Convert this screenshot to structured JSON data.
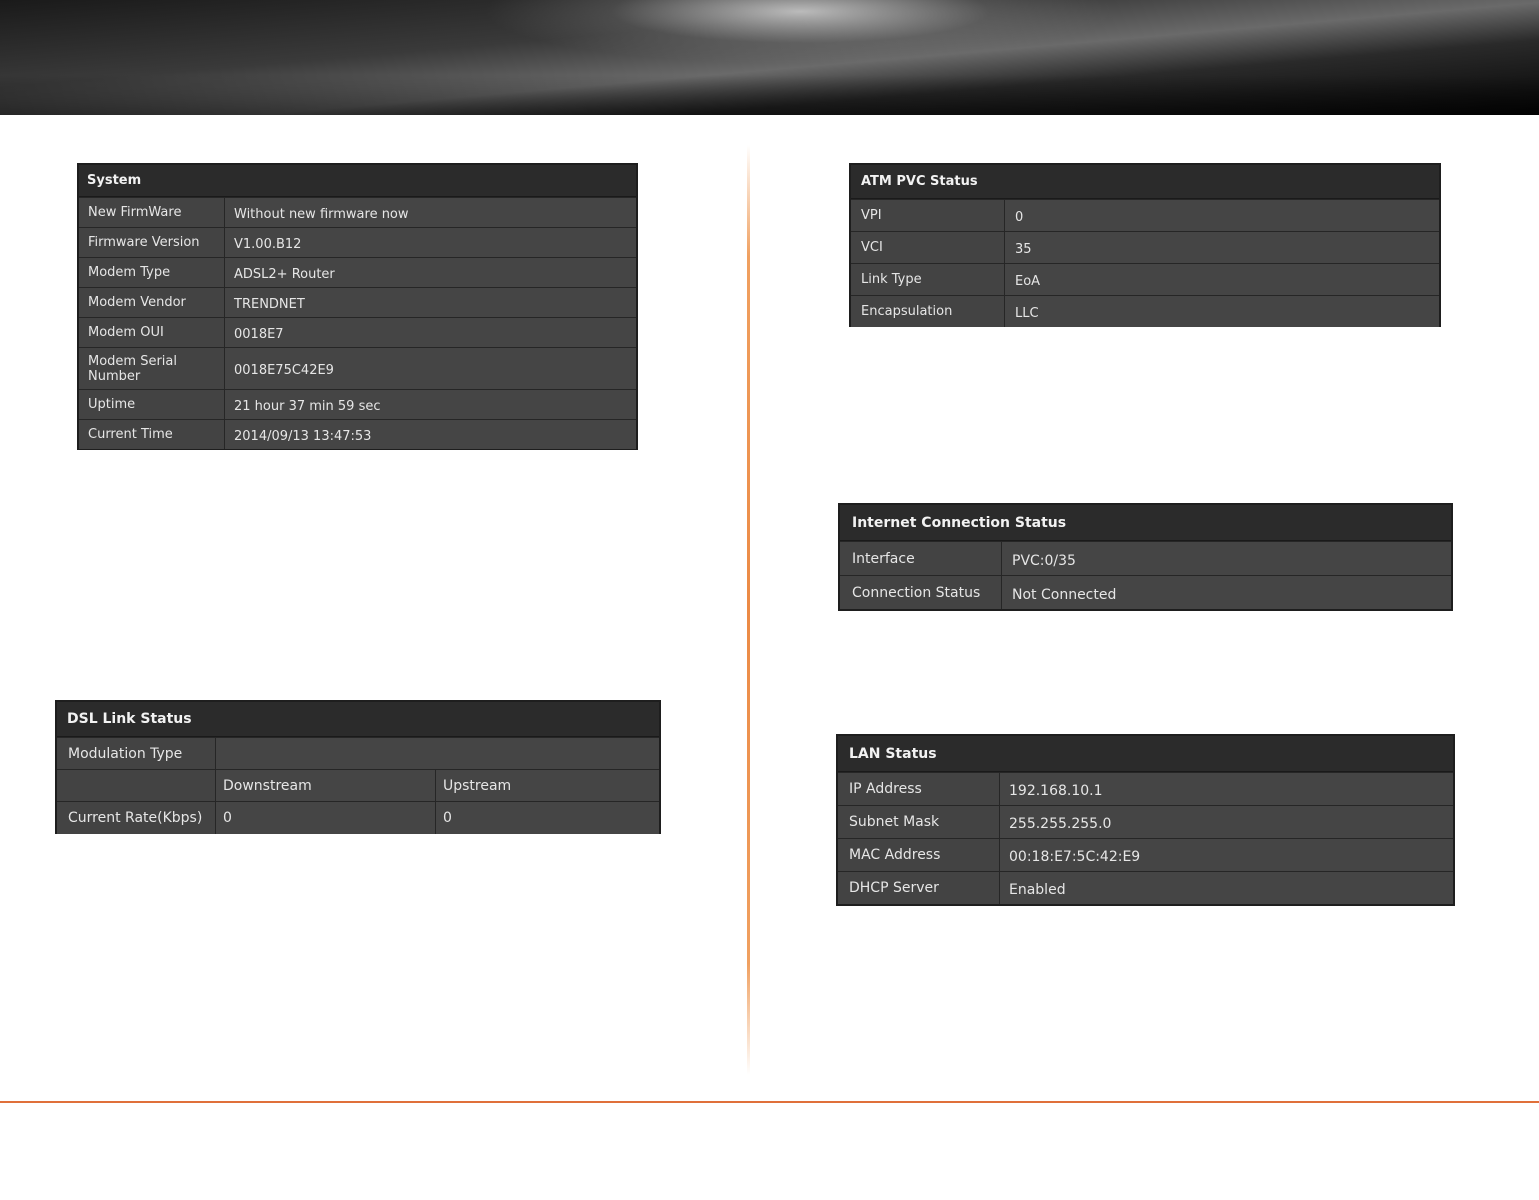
{
  "system": {
    "title": "System",
    "rows": [
      {
        "label": "New FirmWare",
        "value": "Without new firmware now"
      },
      {
        "label": "Firmware Version",
        "value": "V1.00.B12"
      },
      {
        "label": "Modem Type",
        "value": "ADSL2+ Router"
      },
      {
        "label": "Modem Vendor",
        "value": "TRENDNET"
      },
      {
        "label": "Modem OUI",
        "value": "0018E7"
      },
      {
        "label": "Modem Serial Number",
        "value": "0018E75C42E9"
      },
      {
        "label": "Uptime",
        "value": "21 hour 37 min 59 sec"
      },
      {
        "label": "Current Time",
        "value": "2014/09/13 13:47:53"
      }
    ]
  },
  "atm": {
    "title": "ATM PVC Status",
    "rows": [
      {
        "label": "VPI",
        "value": "0"
      },
      {
        "label": "VCI",
        "value": "35"
      },
      {
        "label": "Link Type",
        "value": "EoA"
      },
      {
        "label": "Encapsulation",
        "value": "LLC"
      }
    ]
  },
  "internet": {
    "title": "Internet Connection Status",
    "rows": [
      {
        "label": "Interface",
        "value": "PVC:0/35"
      },
      {
        "label": "Connection Status",
        "value": "Not Connected"
      }
    ]
  },
  "dsl": {
    "title": "DSL Link Status",
    "modulation_label": "Modulation Type",
    "modulation_value": "",
    "col_downstream": "Downstream",
    "col_upstream": "Upstream",
    "rate_label": "Current Rate(Kbps)",
    "rate_down": "0",
    "rate_up": "0"
  },
  "lan": {
    "title": "LAN Status",
    "rows": [
      {
        "label": "IP Address",
        "value": "192.168.10.1"
      },
      {
        "label": "Subnet Mask",
        "value": "255.255.255.0"
      },
      {
        "label": "MAC Address",
        "value": "00:18:E7:5C:42:E9"
      },
      {
        "label": "DHCP Server",
        "value": "Enabled"
      }
    ]
  }
}
